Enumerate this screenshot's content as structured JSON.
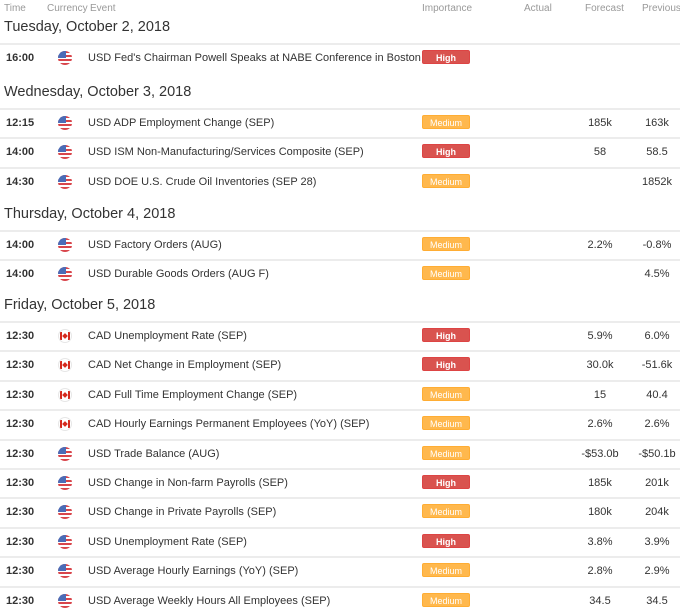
{
  "header": {
    "time": "Time",
    "currency": "Currency",
    "event": "Event",
    "importance": "Importance",
    "actual": "Actual",
    "forecast": "Forecast",
    "previous": "Previous"
  },
  "colors": {
    "high": "#d9534f",
    "medium": "#ffb84d",
    "separator": "#ececec"
  },
  "days": [
    {
      "label": "Tuesday, October 2, 2018",
      "events": [
        {
          "time": "16:00",
          "currency_icon": "us-flag-icon",
          "event": "USD Fed's Chairman Powell Speaks at NABE Conference in Boston",
          "importance": "High",
          "actual": "",
          "forecast": "",
          "previous": ""
        }
      ]
    },
    {
      "label": "Wednesday, October 3, 2018",
      "events": [
        {
          "time": "12:15",
          "currency_icon": "us-flag-icon",
          "event": "USD ADP Employment Change (SEP)",
          "importance": "Medium",
          "actual": "",
          "forecast": "185k",
          "previous": "163k"
        },
        {
          "time": "14:00",
          "currency_icon": "us-flag-icon",
          "event": "USD ISM Non-Manufacturing/Services Composite (SEP)",
          "importance": "High",
          "actual": "",
          "forecast": "58",
          "previous": "58.5"
        },
        {
          "time": "14:30",
          "currency_icon": "us-flag-icon",
          "event": "USD DOE U.S. Crude Oil Inventories (SEP 28)",
          "importance": "Medium",
          "actual": "",
          "forecast": "",
          "previous": "1852k"
        }
      ]
    },
    {
      "label": "Thursday, October 4, 2018",
      "events": [
        {
          "time": "14:00",
          "currency_icon": "us-flag-icon",
          "event": "USD Factory Orders (AUG)",
          "importance": "Medium",
          "actual": "",
          "forecast": "2.2%",
          "previous": "-0.8%"
        },
        {
          "time": "14:00",
          "currency_icon": "us-flag-icon",
          "event": "USD Durable Goods Orders (AUG F)",
          "importance": "Medium",
          "actual": "",
          "forecast": "",
          "previous": "4.5%"
        }
      ]
    },
    {
      "label": "Friday, October 5, 2018",
      "events": [
        {
          "time": "12:30",
          "currency_icon": "ca-flag-icon",
          "event": "CAD Unemployment Rate (SEP)",
          "importance": "High",
          "actual": "",
          "forecast": "5.9%",
          "previous": "6.0%"
        },
        {
          "time": "12:30",
          "currency_icon": "ca-flag-icon",
          "event": "CAD Net Change in Employment (SEP)",
          "importance": "High",
          "actual": "",
          "forecast": "30.0k",
          "previous": "-51.6k"
        },
        {
          "time": "12:30",
          "currency_icon": "ca-flag-icon",
          "event": "CAD Full Time Employment Change (SEP)",
          "importance": "Medium",
          "actual": "",
          "forecast": "15",
          "previous": "40.4"
        },
        {
          "time": "12:30",
          "currency_icon": "ca-flag-icon",
          "event": "CAD Hourly Earnings Permanent Employees (YoY) (SEP)",
          "importance": "Medium",
          "actual": "",
          "forecast": "2.6%",
          "previous": "2.6%"
        },
        {
          "time": "12:30",
          "currency_icon": "us-flag-icon",
          "event": "USD Trade Balance (AUG)",
          "importance": "Medium",
          "actual": "",
          "forecast": "-$53.0b",
          "previous": "-$50.1b"
        },
        {
          "time": "12:30",
          "currency_icon": "us-flag-icon",
          "event": "USD Change in Non-farm Payrolls (SEP)",
          "importance": "High",
          "actual": "",
          "forecast": "185k",
          "previous": "201k"
        },
        {
          "time": "12:30",
          "currency_icon": "us-flag-icon",
          "event": "USD Change in Private Payrolls (SEP)",
          "importance": "Medium",
          "actual": "",
          "forecast": "180k",
          "previous": "204k"
        },
        {
          "time": "12:30",
          "currency_icon": "us-flag-icon",
          "event": "USD Unemployment Rate (SEP)",
          "importance": "High",
          "actual": "",
          "forecast": "3.8%",
          "previous": "3.9%"
        },
        {
          "time": "12:30",
          "currency_icon": "us-flag-icon",
          "event": "USD Average Hourly Earnings (YoY) (SEP)",
          "importance": "Medium",
          "actual": "",
          "forecast": "2.8%",
          "previous": "2.9%"
        },
        {
          "time": "12:30",
          "currency_icon": "us-flag-icon",
          "event": "USD Average Weekly Hours All Employees (SEP)",
          "importance": "Medium",
          "actual": "",
          "forecast": "34.5",
          "previous": "34.5"
        }
      ]
    }
  ]
}
